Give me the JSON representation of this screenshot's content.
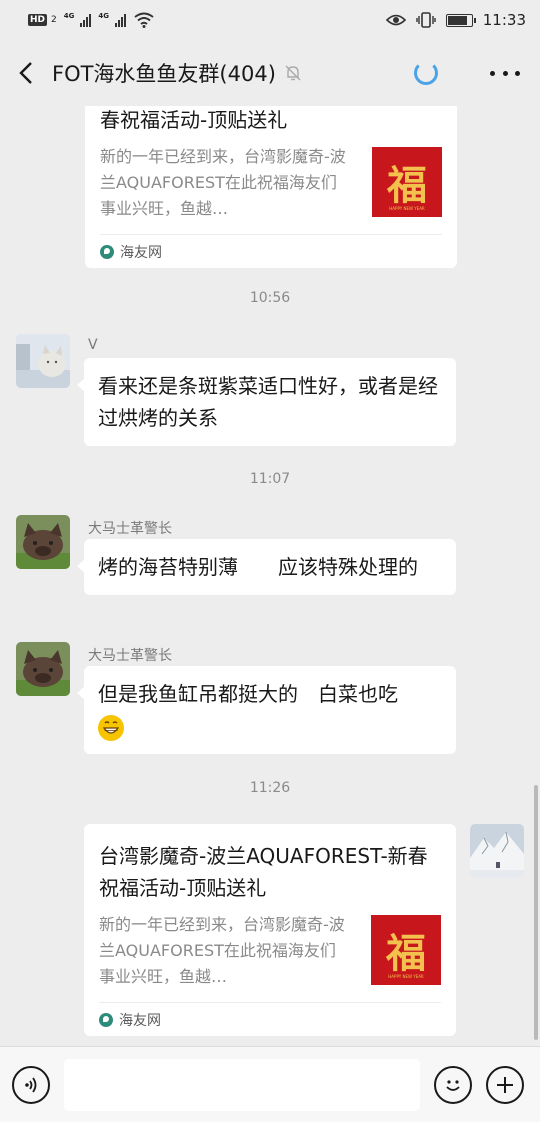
{
  "status_bar": {
    "hd_badge": "HD",
    "hd_sub": "2",
    "network_1": "4G",
    "network_2": "4G",
    "battery_level": 0.75,
    "time": "11:33"
  },
  "nav": {
    "title": "FOT海水鱼鱼友群(404)",
    "icons": [
      "back-arrow-icon",
      "mute-bell-icon",
      "loading-icon",
      "more-icon"
    ]
  },
  "messages": {
    "top_card": {
      "title_tail": "春祝福活动-顶贴送礼",
      "description": "新的一年已经到来，台湾影魔奇-波兰AQUAFOREST在此祝福海友们事业兴旺，鱼越…",
      "thumb_char": "福",
      "thumb_caption": "HAPPY NEW YEAR",
      "source": "海友网"
    },
    "time_1": "10:56",
    "msg_1": {
      "sender": "V",
      "text": "看来还是条斑紫菜适口性好，或者是经过烘烤的关系"
    },
    "time_2": "11:07",
    "msg_2": {
      "sender": "大马士革警长",
      "text": "烤的海苔特别薄　　应该特殊处理的"
    },
    "msg_3": {
      "sender": "大马士革警长",
      "text": "但是我鱼缸吊都挺大的　白菜也吃"
    },
    "time_3": "11:26",
    "bottom_card": {
      "title": "台湾影魔奇-波兰AQUAFOREST-新春祝福活动-顶贴送礼",
      "description": "新的一年已经到来，台湾影魔奇-波兰AQUAFOREST在此祝福海友们事业兴旺，鱼越…",
      "thumb_char": "福",
      "thumb_caption": "HAPPY NEW YEAR",
      "source": "海友网"
    }
  },
  "input_bar": {
    "value": "",
    "icons": [
      "voice-icon",
      "emoji-icon",
      "add-icon"
    ]
  },
  "colors": {
    "background": "#ededed",
    "bubble": "#ffffff",
    "thumb_red": "#c8161d",
    "thumb_gold": "#f2c14e",
    "loading_blue": "#4aa3e6"
  }
}
